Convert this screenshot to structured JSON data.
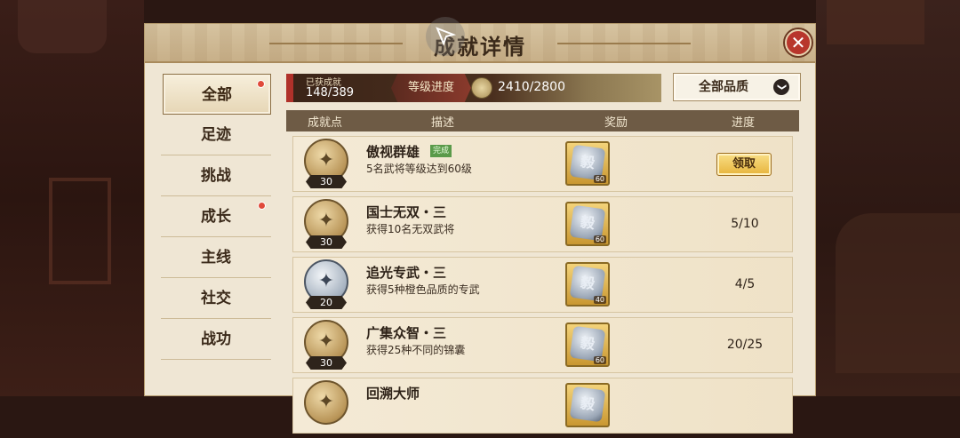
{
  "window": {
    "title": "成就详情",
    "close_glyph": "✕"
  },
  "sidebar": {
    "items": [
      {
        "label": "全部",
        "active": true,
        "dot": true
      },
      {
        "label": "足迹",
        "active": false,
        "dot": false
      },
      {
        "label": "挑战",
        "active": false,
        "dot": false
      },
      {
        "label": "成长",
        "active": false,
        "dot": true
      },
      {
        "label": "主线",
        "active": false,
        "dot": false
      },
      {
        "label": "社交",
        "active": false,
        "dot": false
      },
      {
        "label": "战功",
        "active": false,
        "dot": false
      }
    ]
  },
  "summary": {
    "obtained_label": "已获成就",
    "obtained_count": "148/389",
    "level_label": "等级进度",
    "level_points": "2410/2800"
  },
  "filter": {
    "selected": "全部品质",
    "chevron": "❯"
  },
  "table": {
    "headers": {
      "points": "成就点",
      "desc": "描述",
      "reward": "奖励",
      "progress": "进度"
    },
    "rows": [
      {
        "medal": "gold",
        "points": "30",
        "name": "傲视群雄",
        "done_badge": "完成",
        "desc": "5名武将等级达到60级",
        "reward_glyph": "毅",
        "reward_count": "60",
        "claim_label": "领取",
        "progress": ""
      },
      {
        "medal": "gold",
        "points": "30",
        "name": "国士无双・三",
        "done_badge": "",
        "desc": "获得10名无双武将",
        "reward_glyph": "毅",
        "reward_count": "60",
        "claim_label": "",
        "progress": "5/10"
      },
      {
        "medal": "silver",
        "points": "20",
        "name": "追光专武・三",
        "done_badge": "",
        "desc": "获得5种橙色品质的专武",
        "reward_glyph": "毅",
        "reward_count": "40",
        "claim_label": "",
        "progress": "4/5"
      },
      {
        "medal": "gold",
        "points": "30",
        "name": "广集众智・三",
        "done_badge": "",
        "desc": "获得25种不同的锦囊",
        "reward_glyph": "毅",
        "reward_count": "60",
        "claim_label": "",
        "progress": "20/25"
      },
      {
        "medal": "gold",
        "points": "",
        "name": "回溯大师",
        "done_badge": "",
        "desc": "",
        "reward_glyph": "毅",
        "reward_count": "",
        "claim_label": "",
        "progress": ""
      }
    ]
  },
  "colors": {
    "panel_bg": "#efe6d4",
    "accent_red": "#b0312a",
    "gold": "#e7b43c"
  },
  "icons": {
    "close": "close-icon",
    "cursor": "cursor-icon",
    "medal": "medal-icon",
    "reward": "reward-token-icon"
  }
}
